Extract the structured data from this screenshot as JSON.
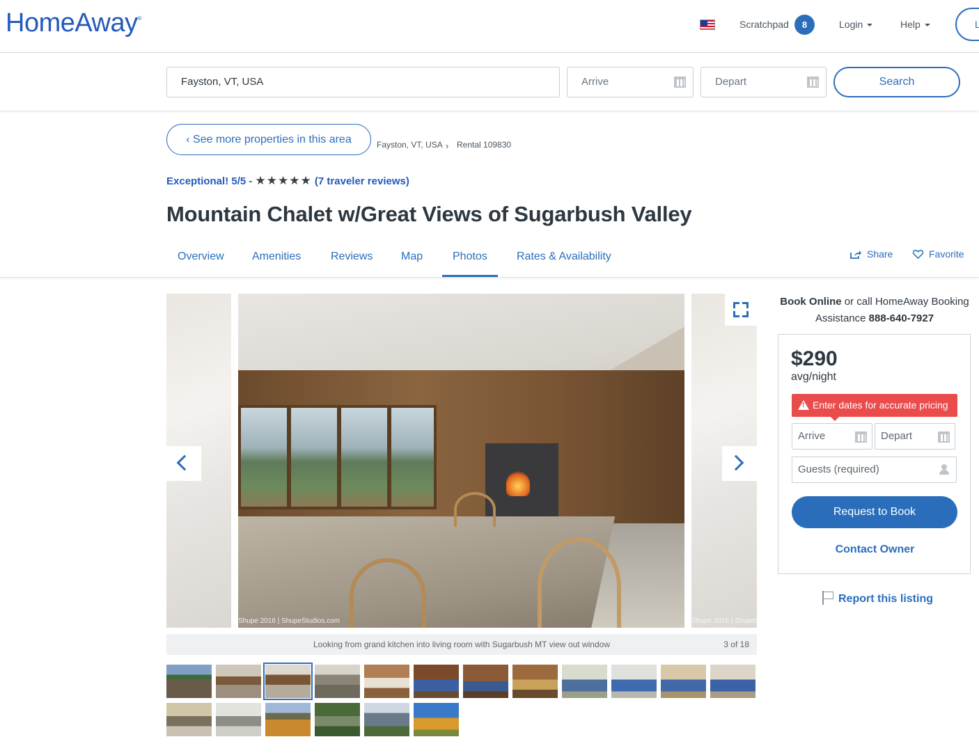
{
  "header": {
    "logo": "HomeAway",
    "logo_mark": "®",
    "flag_icon": "us-flag-icon",
    "scratchpad_label": "Scratchpad",
    "scratchpad_count": "8",
    "login_label": "Login",
    "help_label": "Help",
    "list_label": "L"
  },
  "search": {
    "location_value": "Fayston, VT, USA",
    "arrive_placeholder": "Arrive",
    "depart_placeholder": "Depart",
    "search_label": "Search"
  },
  "breadcrumb": {
    "back_label": "See more properties in this area",
    "items": [
      "Fayston, VT, USA",
      "Rental 109830"
    ]
  },
  "listing": {
    "rating_prefix": "Exceptional! 5/5 -",
    "stars": "★★★★★",
    "reviews_link": "(7 traveler reviews)",
    "title": "Mountain Chalet w/Great Views of Sugarbush Valley"
  },
  "tabs": {
    "items": [
      "Overview",
      "Amenities",
      "Reviews",
      "Map",
      "Photos",
      "Rates & Availability"
    ],
    "active": "Photos",
    "share_label": "Share",
    "favorite_label": "Favorite"
  },
  "gallery": {
    "watermark": "Shupe 2016 | ShupeStudios.com",
    "watermark_right": "Shupe 2016 | ShupeS",
    "caption": "Looking from grand kitchen into living room with Sugarbush MT view out window",
    "counter": "3 of 18",
    "thumbnail_count": 18,
    "active_thumbnail": 3
  },
  "booking": {
    "info_bold": "Book Online",
    "info_text": " or call HomeAway Booking Assistance ",
    "phone": "888-640-7927",
    "price": "$290",
    "per_night": "avg/night",
    "warning": "Enter dates for accurate pricing",
    "arrive_placeholder": "Arrive",
    "depart_placeholder": "Depart",
    "guests_placeholder": "Guests (required)",
    "request_label": "Request to Book",
    "contact_label": "Contact Owner",
    "report_label": "Report this listing"
  },
  "colors": {
    "brand_blue": "#2a6ebb",
    "logo_blue": "#245abc",
    "warning_red": "#ea4b4b",
    "text_dark": "#2d3740"
  }
}
